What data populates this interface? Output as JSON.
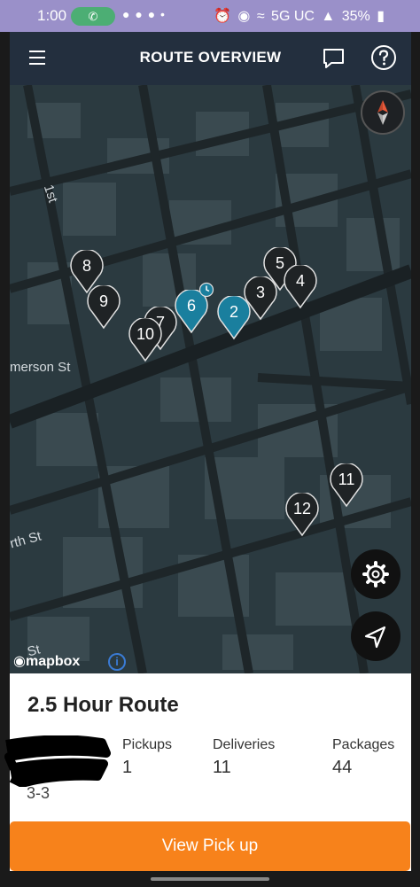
{
  "status_bar": {
    "time": "1:00",
    "right_text": "5G UC",
    "battery": "35%"
  },
  "header": {
    "title": "ROUTE OVERVIEW"
  },
  "map": {
    "street_labels": [
      "1st",
      "merson St",
      "rth St",
      "St"
    ],
    "attribution": "mapbox",
    "pins": [
      {
        "label": "8",
        "active": false
      },
      {
        "label": "9",
        "active": false
      },
      {
        "label": "7",
        "active": false
      },
      {
        "label": "10",
        "active": false
      },
      {
        "label": "6",
        "active": true
      },
      {
        "label": "2",
        "active": true
      },
      {
        "label": "3",
        "active": false
      },
      {
        "label": "5",
        "active": false
      },
      {
        "label": "4",
        "active": false
      },
      {
        "label": "11",
        "active": false
      },
      {
        "label": "12",
        "active": false
      }
    ]
  },
  "route": {
    "title": "2.5 Hour Route",
    "code": "3-3",
    "stats": [
      {
        "label": "Pickups",
        "value": "1"
      },
      {
        "label": "Deliveries",
        "value": "11"
      },
      {
        "label": "Packages",
        "value": "44"
      }
    ]
  },
  "actions": {
    "primary_label": "View Pick up"
  },
  "colors": {
    "accent": "#f7821b",
    "header": "#232f3e",
    "pin_active": "#1a7f9e",
    "map_bg": "#2b3a40"
  }
}
